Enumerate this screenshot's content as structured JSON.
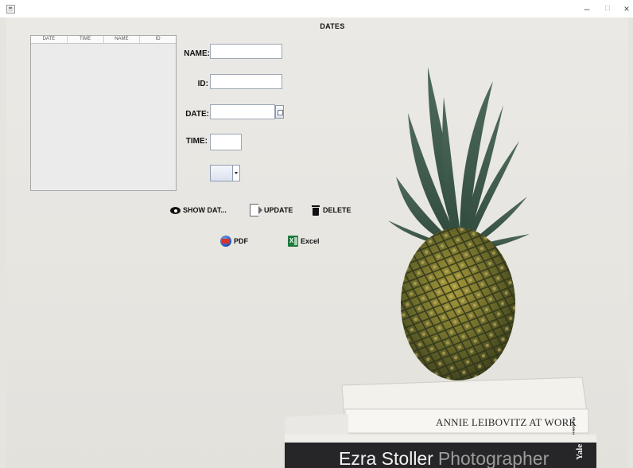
{
  "window": {
    "title": "",
    "frame_title": "DATES"
  },
  "table": {
    "columns": [
      "DATE",
      "TIME",
      "NAME",
      "ID"
    ],
    "rows": []
  },
  "form": {
    "name_label": "NAME:",
    "name_value": "",
    "id_label": "ID:",
    "id_value": "",
    "date_label": "DATE:",
    "date_value": "",
    "time_label": "TIME:",
    "time_value": ""
  },
  "buttons": {
    "show_data": "SHOW DAT...",
    "update": "UPDATE",
    "delete": "DELETE",
    "pdf": "PDF",
    "excel": "Excel"
  },
  "books": {
    "top_title": "ANNIE LEIBOVITZ AT WORK",
    "top_spine_publisher": "RANDOM HOUSE",
    "bottom_title_a": "Ezra Stoller",
    "bottom_title_b": "Photographer",
    "bottom_spine": "Yale"
  },
  "colors": {
    "background": "#e6e4df",
    "excel_green": "#1f7a3f",
    "pdf_red": "#d6332c"
  }
}
